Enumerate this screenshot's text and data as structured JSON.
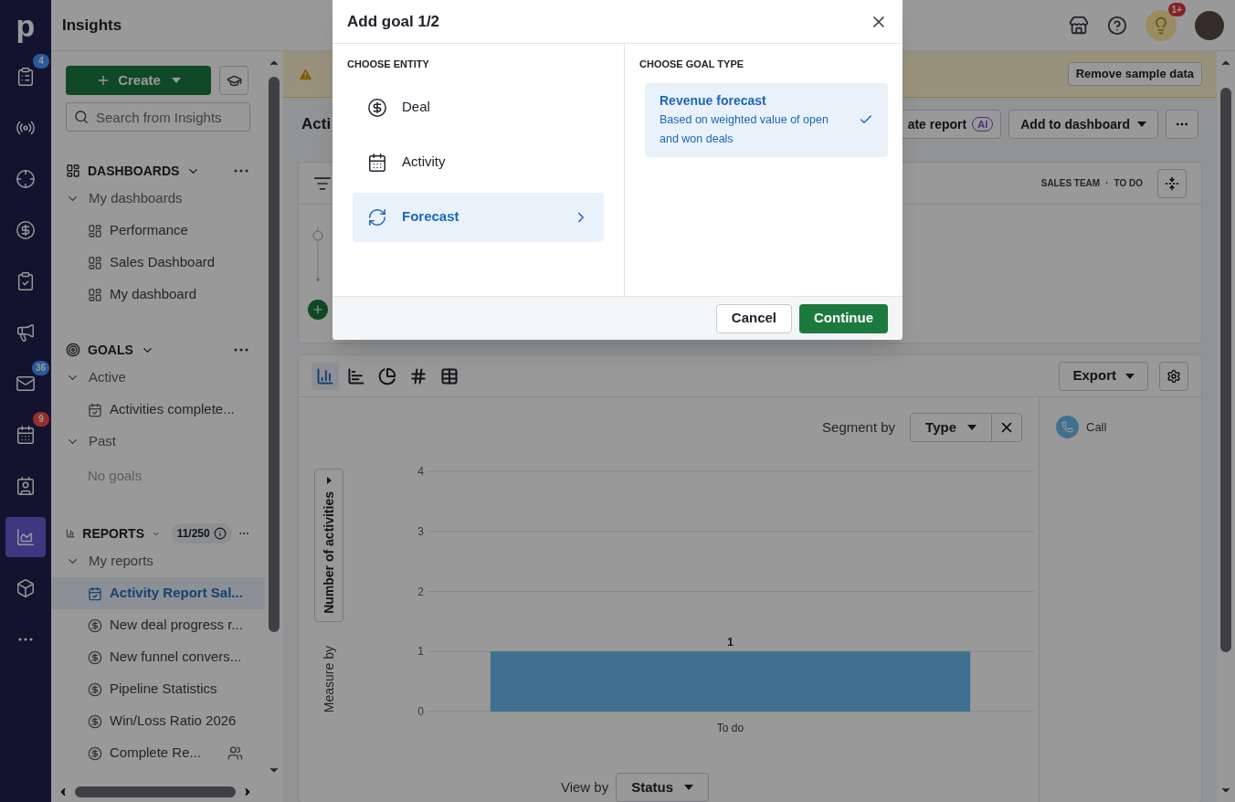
{
  "rail": {
    "logo": "p",
    "items": [
      {
        "kind": "leads",
        "selected": false,
        "badge": {
          "text": "4",
          "color": "#2c5a9c"
        }
      },
      {
        "kind": "signals",
        "selected": false
      },
      {
        "kind": "projects",
        "selected": false
      },
      {
        "kind": "deals",
        "selected": false
      },
      {
        "kind": "tasks",
        "selected": false
      },
      {
        "kind": "campaigns",
        "selected": false
      },
      {
        "kind": "mail",
        "selected": false,
        "badge": {
          "text": "36",
          "color": "#2c5a9c"
        }
      },
      {
        "kind": "calendar",
        "selected": false,
        "badge": {
          "text": "9",
          "color": "#96302f"
        }
      },
      {
        "kind": "contacts",
        "selected": false
      },
      {
        "kind": "insights",
        "selected": true
      },
      {
        "kind": "products",
        "selected": false
      },
      {
        "kind": "more",
        "selected": false
      }
    ]
  },
  "header": {
    "title": "Insights",
    "tips_badge": "1+"
  },
  "sidebar": {
    "create": "Create",
    "search": {
      "placeholder": "Search from Insights"
    },
    "sections": [
      {
        "kind": "dashboards",
        "title": "DASHBOARDS",
        "expanded": true,
        "groups": [
          {
            "label": "My dashboards",
            "expanded": true,
            "items": [
              {
                "kind": "dashboard",
                "label": "Performance",
                "selected": false,
                "shared": false
              },
              {
                "kind": "dashboard",
                "label": "Sales Dashboard",
                "selected": false,
                "shared": false
              },
              {
                "kind": "dashboard",
                "label": "My dashboard",
                "selected": false,
                "shared": false
              }
            ]
          }
        ]
      },
      {
        "kind": "goals",
        "title": "GOALS",
        "expanded": true,
        "groups": [
          {
            "label": "Active",
            "expanded": true,
            "items": [
              {
                "kind": "activity",
                "label": "Activities complete...",
                "selected": false,
                "shared": false
              }
            ]
          },
          {
            "label": "Past",
            "expanded": true,
            "empty": "No goals"
          }
        ]
      },
      {
        "kind": "reports",
        "title": "REPORTS",
        "count": "11/250",
        "expanded": true,
        "groups": [
          {
            "label": "My reports",
            "expanded": true,
            "items": [
              {
                "kind": "activity",
                "label": "Activity Report Sal...",
                "selected": true,
                "shared": false
              },
              {
                "kind": "deal",
                "label": "New deal progress r...",
                "selected": false,
                "shared": false
              },
              {
                "kind": "deal",
                "label": "New funnel convers...",
                "selected": false,
                "shared": false
              },
              {
                "kind": "deal",
                "label": "Pipeline Statistics",
                "selected": false,
                "shared": false
              },
              {
                "kind": "deal",
                "label": "Win/Loss Ratio 2026",
                "selected": false,
                "shared": false
              },
              {
                "kind": "deal",
                "label": "Complete Re...",
                "selected": false,
                "shared": true
              }
            ]
          }
        ]
      }
    ]
  },
  "banner": {
    "button": "Remove sample data"
  },
  "report": {
    "title": "Acti",
    "create_button": "ate report",
    "ai_badge": "AI",
    "add_button": "Add to dashboard"
  },
  "filters": {
    "tags": [
      "SALES TEAM",
      "TO DO"
    ],
    "separator": "·"
  },
  "chart_card": {
    "chart_types": [
      {
        "kind": "column",
        "selected": true
      },
      {
        "kind": "bar",
        "selected": false
      },
      {
        "kind": "pie",
        "selected": false
      },
      {
        "kind": "number",
        "selected": false
      },
      {
        "kind": "table",
        "selected": false
      }
    ],
    "export": "Export",
    "segment_label": "Segment by",
    "segment_value": "Type",
    "measure_label": "Measure by",
    "measure_value": "Number of activities",
    "view_label": "View by",
    "view_value": "Status",
    "chart_data": {
      "type": "bar",
      "categories": [
        "To do"
      ],
      "series": [
        {
          "name": "Call",
          "color": "#6cbbee",
          "values": [
            1
          ]
        }
      ],
      "ylim": [
        0,
        4
      ],
      "yticks": [
        0,
        1,
        2,
        3,
        4
      ],
      "grid": true,
      "data_labels": true
    }
  },
  "modal": {
    "title": "Add goal 1/2",
    "entity_heading": "CHOOSE ENTITY",
    "entities": [
      {
        "kind": "deal",
        "label": "Deal",
        "selected": false
      },
      {
        "kind": "activity",
        "label": "Activity",
        "selected": false
      },
      {
        "kind": "forecast",
        "label": "Forecast",
        "selected": true
      }
    ],
    "type_heading": "CHOOSE GOAL TYPE",
    "goal_types": [
      {
        "title": "Revenue forecast",
        "description": "Based on weighted value of open and won deals",
        "selected": true
      }
    ],
    "cancel": "Cancel",
    "continue": "Continue"
  }
}
